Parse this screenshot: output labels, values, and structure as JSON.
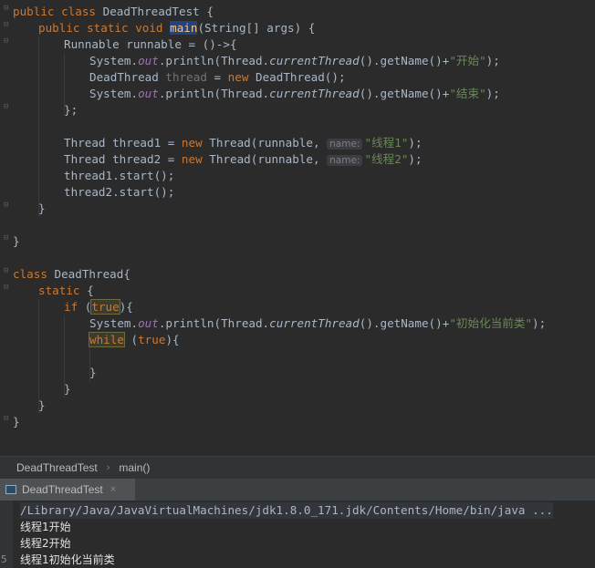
{
  "code": {
    "l1": [
      "public",
      "class",
      "DeadThreadTest",
      "{"
    ],
    "l2": [
      "public",
      "static",
      "void",
      "main",
      "(String[] args) {"
    ],
    "l3": "Runnable runnable = ()->{",
    "l4": [
      "System.",
      "out",
      ".println(Thread.",
      "currentThread",
      "().getName()+",
      "\"开始\"",
      ");"
    ],
    "l5": [
      "DeadThread ",
      "thread",
      " = ",
      "new",
      " DeadThread();"
    ],
    "l6": [
      "System.",
      "out",
      ".println(Thread.",
      "currentThread",
      "().getName()+",
      "\"结束\"",
      ");"
    ],
    "l7": "};",
    "l9": [
      "Thread thread1 = ",
      "new",
      " Thread(runnable, ",
      "name:",
      "\"线程1\"",
      ");"
    ],
    "l10": [
      "Thread thread2 = ",
      "new",
      " Thread(runnable, ",
      "name:",
      "\"线程2\"",
      ");"
    ],
    "l11": "thread1.start();",
    "l12": "thread2.start();",
    "l13": "}",
    "l15": "}",
    "l17": [
      "class",
      " DeadThread{"
    ],
    "l18": [
      "static",
      " {"
    ],
    "l19": [
      "if",
      " (",
      "true",
      "){"
    ],
    "l20": [
      "System.",
      "out",
      ".println(Thread.",
      "currentThread",
      "().getName()+",
      "\"初始化当前类\"",
      ");"
    ],
    "l21": [
      "while",
      " (",
      "true",
      "){"
    ],
    "l23": "}",
    "l24": "}",
    "l25": "}",
    "l26": "}"
  },
  "breadcrumb": {
    "class": "DeadThreadTest",
    "method": "main()"
  },
  "run_tab": {
    "label": "DeadThreadTest",
    "close": "×"
  },
  "console": {
    "command": "/Library/Java/JavaVirtualMachines/jdk1.8.0_171.jdk/Contents/Home/bin/java ...",
    "lines": [
      "线程1开始",
      "线程2开始",
      "线程1初始化当前类"
    ],
    "gutter_digit": "5"
  },
  "icons": {
    "fold": "fold-marker-icon",
    "run_tab": "run-console-icon",
    "close": "close-icon",
    "breadcrumb_sep": "chevron-right-icon"
  },
  "colors": {
    "background": "#2b2b2b",
    "keyword": "#cc7832",
    "string": "#6a8759",
    "field": "#9876aa",
    "text": "#a9b7c6",
    "tab_accent": "#4a88c7"
  }
}
